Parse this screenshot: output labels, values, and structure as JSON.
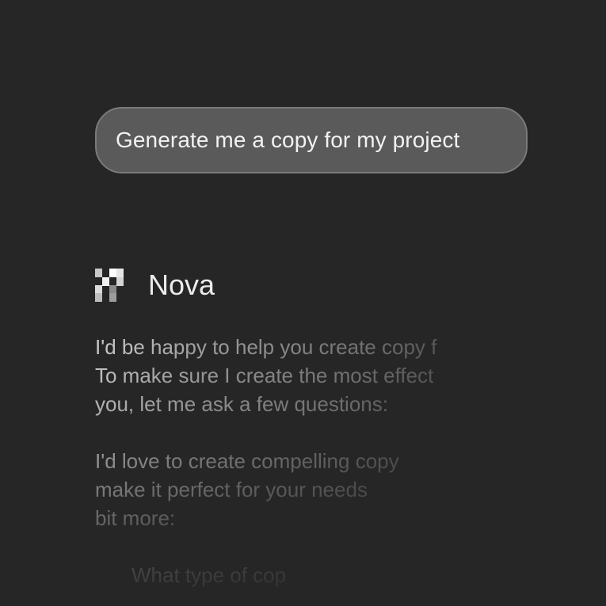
{
  "conversation": {
    "user_message": "Generate me a copy for my project",
    "assistant": {
      "name": "Nova",
      "logo_icon": "pixel-grid-logo-icon",
      "response_lines": [
        "I'd be happy to help you create copy f",
        "To make sure I create the most effect",
        "you, let me ask a few questions:",
        "I'd love to create compelling copy",
        "make it perfect for your needs",
        "bit more:",
        "What type of cop"
      ]
    }
  },
  "colors": {
    "background": "#262626",
    "bubble_fill": "#5a5a5a",
    "bubble_border": "#7a7a7a",
    "text_primary": "#f2f2f2",
    "text_response": "#cfcfcf"
  }
}
